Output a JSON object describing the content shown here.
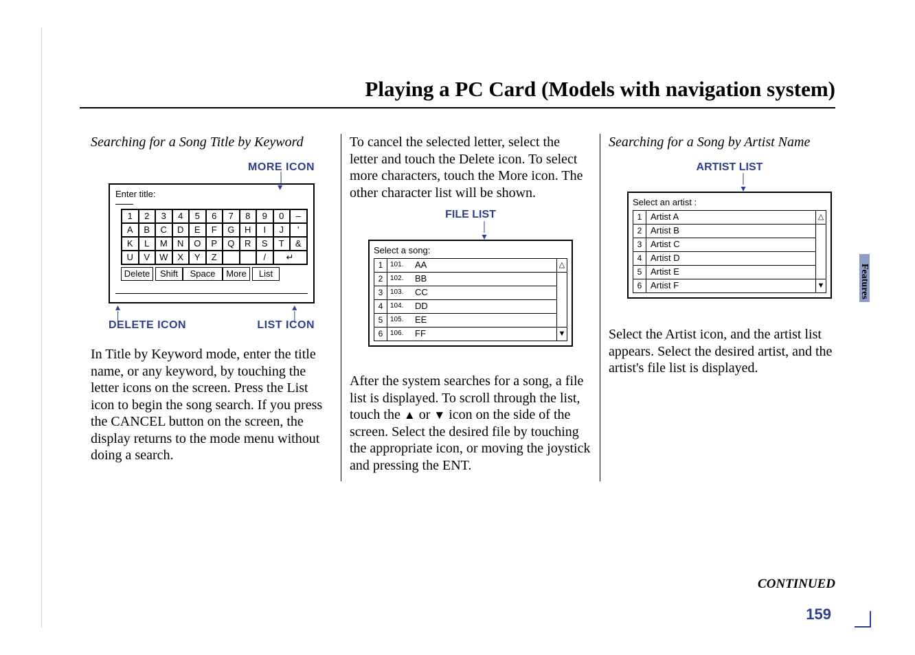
{
  "page_title": "Playing a PC Card (Models with navigation system)",
  "sidebar_tab": "Features",
  "continued": "CONTINUED",
  "page_number": "159",
  "col1": {
    "subtitle": "Searching for a Song Title by Keyword",
    "more_icon_label": "MORE ICON",
    "delete_icon_label": "DELETE ICON",
    "list_icon_label": "LIST ICON",
    "kbd_title": "Enter title:",
    "rows": {
      "r1": [
        "1",
        "2",
        "3",
        "4",
        "5",
        "6",
        "7",
        "8",
        "9",
        "0",
        "–"
      ],
      "r2": [
        "A",
        "B",
        "C",
        "D",
        "E",
        "F",
        "G",
        "H",
        "I",
        "J",
        "'"
      ],
      "r3": [
        "K",
        "L",
        "M",
        "N",
        "O",
        "P",
        "Q",
        "R",
        "S",
        "T",
        "&"
      ],
      "r4_left": [
        "U",
        "V",
        "W",
        "X",
        "Y",
        "Z"
      ],
      "r4_slash": "/",
      "r4_enter": "↵",
      "r5": {
        "delete": "Delete",
        "shift": "Shift",
        "space": "Space",
        "more": "More",
        "list": "List"
      }
    },
    "paragraph": "In Title by Keyword mode, enter the title name, or any keyword, by touching the letter icons on the screen. Press the List icon to begin the song search. If you press the CANCEL button on the screen, the display returns to the mode menu without doing a search."
  },
  "col2": {
    "para1": "To cancel the selected letter, select the letter and touch the Delete icon. To select more characters, touch the More icon. The other character list will be shown.",
    "file_list_label": "FILE LIST",
    "select_prompt": "Select a song:",
    "songs": [
      {
        "idx": "1",
        "track": "101.",
        "name": "AA"
      },
      {
        "idx": "2",
        "track": "102.",
        "name": "BB"
      },
      {
        "idx": "3",
        "track": "103.",
        "name": "CC"
      },
      {
        "idx": "4",
        "track": "104.",
        "name": "DD"
      },
      {
        "idx": "5",
        "track": "105.",
        "name": "EE"
      },
      {
        "idx": "6",
        "track": "106.",
        "name": "FF"
      }
    ],
    "para2_a": "After the system searches for a song, a file list is displayed. To scroll through the list, touch the ",
    "up_tri": "▲",
    "para2_b": " or ",
    "down_tri": "▼",
    "para2_c": " icon on the side of the screen. Select the desired file by touching the appropriate icon, or moving the joystick and pressing the ENT."
  },
  "col3": {
    "subtitle": "Searching for a Song by Artist Name",
    "artist_list_label": "ARTIST LIST",
    "select_prompt": "Select an artist :",
    "artists": [
      {
        "idx": "1",
        "name": "Artist  A"
      },
      {
        "idx": "2",
        "name": "Artist  B"
      },
      {
        "idx": "3",
        "name": "Artist  C"
      },
      {
        "idx": "4",
        "name": "Artist  D"
      },
      {
        "idx": "5",
        "name": "Artist  E"
      },
      {
        "idx": "6",
        "name": "Artist  F"
      }
    ],
    "paragraph": "Select the Artist icon, and the artist list appears. Select the desired artist, and the artist's file list is displayed."
  }
}
